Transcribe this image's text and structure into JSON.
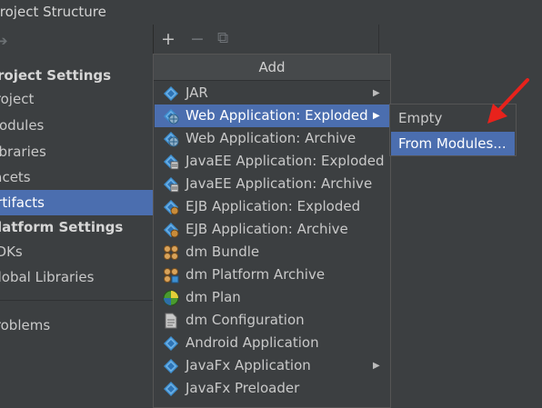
{
  "window": {
    "title": "Project Structure"
  },
  "sidebar": {
    "items": [
      {
        "label": "Project Settings",
        "type": "header"
      },
      {
        "label": "Project",
        "type": "item"
      },
      {
        "label": "Modules",
        "type": "item"
      },
      {
        "label": "Libraries",
        "type": "item"
      },
      {
        "label": "Facets",
        "type": "item"
      },
      {
        "label": "Artifacts",
        "type": "item",
        "selected": true
      },
      {
        "label": "Platform Settings",
        "type": "header"
      },
      {
        "label": "SDKs",
        "type": "item"
      },
      {
        "label": "Global Libraries",
        "type": "item"
      },
      {
        "label": "Problems",
        "type": "item"
      }
    ]
  },
  "toolbar": {
    "add": "+",
    "remove": "−",
    "copy": "⧉"
  },
  "add_menu": {
    "title": "Add",
    "items": [
      {
        "label": "JAR",
        "icon": "diamond-icon",
        "has_submenu": true
      },
      {
        "label": "Web Application: Exploded",
        "icon": "web-app-icon",
        "has_submenu": true,
        "selected": true
      },
      {
        "label": "Web Application: Archive",
        "icon": "web-app-icon"
      },
      {
        "label": "JavaEE Application: Exploded",
        "icon": "javaee-icon"
      },
      {
        "label": "JavaEE Application: Archive",
        "icon": "javaee-icon"
      },
      {
        "label": "EJB Application: Exploded",
        "icon": "ejb-icon"
      },
      {
        "label": "EJB Application: Archive",
        "icon": "ejb-icon"
      },
      {
        "label": "dm Bundle",
        "icon": "bundle-icon"
      },
      {
        "label": "dm Platform Archive",
        "icon": "platform-archive-icon"
      },
      {
        "label": "dm Plan",
        "icon": "plan-icon"
      },
      {
        "label": "dm Configuration",
        "icon": "configuration-icon"
      },
      {
        "label": "Android Application",
        "icon": "diamond-icon"
      },
      {
        "label": "JavaFx Application",
        "icon": "diamond-icon",
        "has_submenu": true
      },
      {
        "label": "JavaFx Preloader",
        "icon": "diamond-icon"
      }
    ]
  },
  "submenu": {
    "items": [
      {
        "label": "Empty"
      },
      {
        "label": "From Modules...",
        "selected": true
      }
    ]
  },
  "colors": {
    "selection": "#4b6eaf",
    "background": "#3c3f41",
    "annotation_arrow": "#e8221c"
  }
}
